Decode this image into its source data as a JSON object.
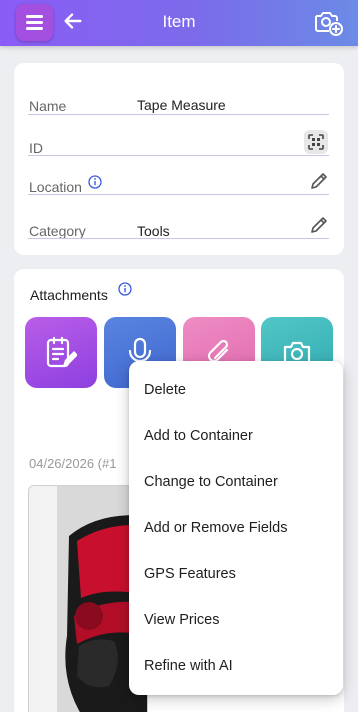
{
  "header": {
    "title": "Item"
  },
  "details": {
    "name_label": "Name",
    "name_value": "Tape Measure",
    "id_label": "ID",
    "location_label": "Location",
    "category_label": "Category",
    "category_value": "Tools"
  },
  "attachments": {
    "label": "Attachments",
    "tiles": [
      {
        "icon": "note-edit-icon",
        "color": "#a04fe6"
      },
      {
        "icon": "microphone-icon",
        "color": "#4f78d9"
      },
      {
        "icon": "paperclip-icon",
        "color": "#e57ab8"
      },
      {
        "icon": "camera-icon",
        "color": "#3fb8bd"
      }
    ],
    "date_text": "04/26/2026 (#1"
  },
  "context_menu": {
    "items": [
      "Delete",
      "Add to Container",
      "Change to Container",
      "Add or Remove Fields",
      "GPS Features",
      "View Prices",
      "Refine with AI"
    ]
  },
  "colors": {
    "header_start": "#8b5cf6",
    "header_end": "#6b8be6",
    "menu_button": "#a34fe0"
  }
}
